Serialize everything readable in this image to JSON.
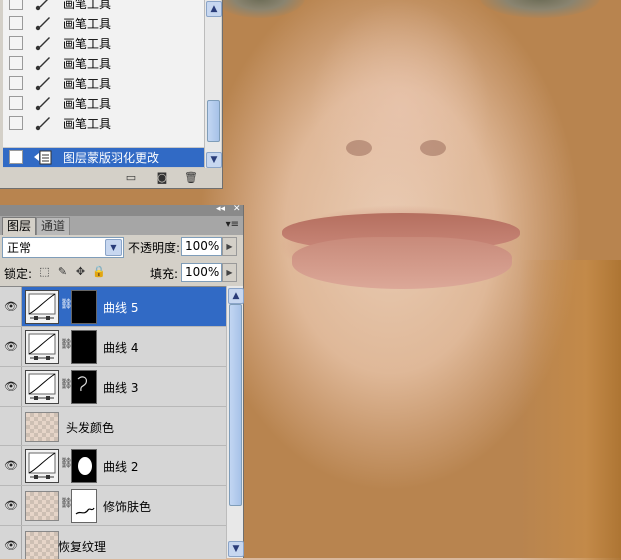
{
  "history": {
    "items": [
      {
        "label": "画笔工具",
        "icon": "brush-icon"
      },
      {
        "label": "画笔工具",
        "icon": "brush-icon"
      },
      {
        "label": "画笔工具",
        "icon": "brush-icon"
      },
      {
        "label": "画笔工具",
        "icon": "brush-icon"
      },
      {
        "label": "画笔工具",
        "icon": "brush-icon"
      },
      {
        "label": "画笔工具",
        "icon": "brush-icon"
      },
      {
        "label": "画笔工具",
        "icon": "brush-icon"
      },
      {
        "label": "图层蒙版羽化更改",
        "icon": "mask-feather-icon",
        "active": true
      }
    ]
  },
  "layers_panel": {
    "tabs": [
      "图层",
      "通道"
    ],
    "blend_mode": "正常",
    "opacity_label": "不透明度:",
    "opacity_value": "100%",
    "lock_label": "锁定:",
    "fill_label": "填充:",
    "fill_value": "100%",
    "layers": [
      {
        "name": "曲线 5",
        "kind": "curves",
        "selected": true
      },
      {
        "name": "曲线 4",
        "kind": "curves"
      },
      {
        "name": "曲线 3",
        "kind": "curves"
      },
      {
        "name": "头发颜色",
        "kind": "pixel"
      },
      {
        "name": "曲线 2",
        "kind": "curves"
      },
      {
        "name": "修饰肤色",
        "kind": "pixel-mask"
      },
      {
        "name": "恢复纹理",
        "kind": "pixel"
      }
    ]
  },
  "colors": {
    "selection": "#316ac5",
    "panel_bg": "#d4d0c8"
  }
}
